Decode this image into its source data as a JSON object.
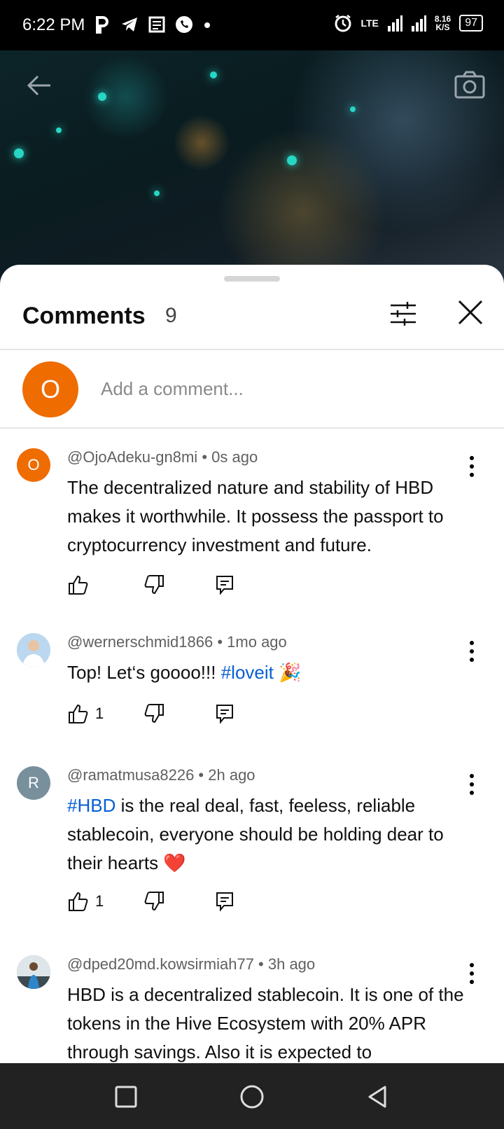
{
  "status": {
    "time": "6:22 PM",
    "network": "LTE",
    "speed_value": "8.16",
    "speed_unit": "K/S",
    "battery": "97",
    "left_icons": [
      "parking-icon",
      "telegram-icon",
      "news-icon",
      "whatsapp-icon",
      "dot-icon"
    ]
  },
  "comments_sheet": {
    "title": "Comments",
    "count": "9",
    "add_comment": {
      "avatar_letter": "O",
      "placeholder": "Add a comment..."
    },
    "items": [
      {
        "avatar_letter": "O",
        "avatar_color": "#ef6c00",
        "author": "@OjoAdeku-gn8mi",
        "time": "0s ago",
        "text": "The decentralized nature and stability of HBD makes it worthwhile.  It possess the passport to cryptocurrency investment and future.",
        "likes": ""
      },
      {
        "avatar_letter": "",
        "avatar_color": "#9cc3e6",
        "author": "@wernerschmid1866",
        "time": "1mo ago",
        "text_pre": "Top! Let‘s goooo!!! ",
        "hashtag": "#loveit",
        "emoji": "🎉",
        "likes": "1"
      },
      {
        "avatar_letter": "R",
        "avatar_color": "#78909c",
        "author": "@ramatmusa8226",
        "time": "2h ago",
        "hashtag": "#HBD",
        "text_post": " is the real deal, fast, feeless, reliable stablecoin, everyone should be holding dear to their hearts ",
        "emoji": "❤️",
        "likes": "1"
      },
      {
        "avatar_letter": "",
        "avatar_color": "#5d6d7a",
        "author": "@dped20md.kowsirmiah77",
        "time": "3h ago",
        "text": "HBD is a decentralized stablecoin.  It is one of the tokens in the Hive Ecosystem with 20% APR through savings.  Also it is expected to",
        "likes": ""
      }
    ]
  },
  "colors": {
    "accent_link": "#065fd4",
    "avatar_orange": "#ef6c00"
  }
}
